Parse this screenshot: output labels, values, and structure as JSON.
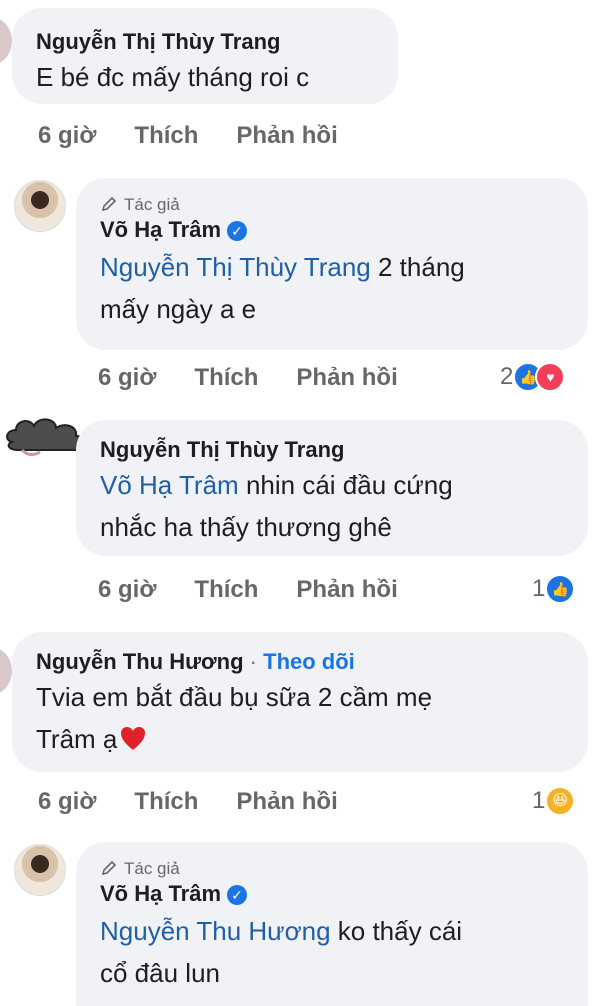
{
  "comments": [
    {
      "name": "Nguyễn Thị Thùy Trang",
      "text": "E bé đc mấy tháng roi c",
      "time": "6 giờ",
      "like": "Thích",
      "reply": "Phản hồi"
    },
    {
      "author_tag": "Tác giả",
      "name": "Võ Hạ Trâm",
      "mention": "Nguyễn Thị Thùy Trang",
      "text_after": " 2 tháng",
      "text_line2": "mấy ngày a e",
      "time": "6 giờ",
      "like": "Thích",
      "reply": "Phản hồi",
      "reaction_count": "2"
    },
    {
      "name": "Nguyễn Thị Thùy Trang",
      "mention": "Võ Hạ Trâm",
      "text_after": " nhin cái đầu cứng",
      "text_line2": "nhắc ha thấy thương ghê",
      "time": "6 giờ",
      "like": "Thích",
      "reply": "Phản hồi",
      "reaction_count": "1"
    },
    {
      "name": "Nguyễn Thu Hương",
      "separator": " · ",
      "follow": "Theo dõi",
      "text": "Tvia em bắt đầu bụ sữa 2 cầm mẹ",
      "text_line2": "Trâm ạ",
      "time": "6 giờ",
      "like": "Thích",
      "reply": "Phản hồi",
      "reaction_count": "1"
    },
    {
      "author_tag": "Tác giả",
      "name": "Võ Hạ Trâm",
      "mention": "Nguyễn Thu Hương",
      "text_after": "  ko thấy cái",
      "text_line2": "cổ đâu lun"
    }
  ],
  "icons": {
    "like": "like-icon",
    "love": "love-icon",
    "haha": "haha-icon",
    "heart": "heart-emoji-icon",
    "verified": "verified-badge-icon",
    "pencil": "pencil-icon"
  },
  "colors": {
    "bubble": "#f0f2f5",
    "mention": "#1f5fa8",
    "like_blue": "#1b74e4",
    "love_red": "#f33e58"
  }
}
